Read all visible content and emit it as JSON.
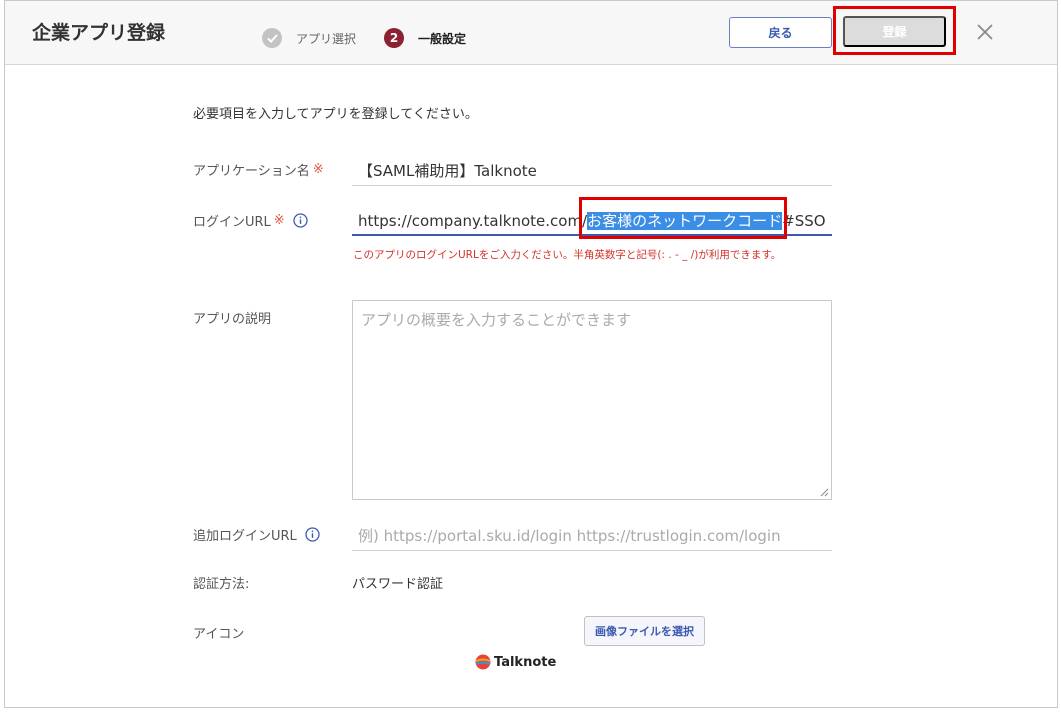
{
  "dialog": {
    "title": "企業アプリ登録"
  },
  "steps": [
    {
      "label": "アプリ選択",
      "number": "✓",
      "status": "done"
    },
    {
      "label": "一般設定",
      "number": "2",
      "status": "current"
    }
  ],
  "header_buttons": {
    "back_label": "戻る",
    "register_label": "登録"
  },
  "form": {
    "intro": "必要項目を入力してアプリを登録してください。",
    "app_name": {
      "label": "アプリケーション名",
      "required_mark": "※",
      "value": "【SAML補助用】Talknote"
    },
    "login_url": {
      "label": "ログインURL",
      "required_mark": "※",
      "value_prefix": "https://company.talknote.com/",
      "value_selected": "お客様のネットワークコード",
      "value_suffix": "#SSO",
      "hint": "このアプリのログインURLをご入力ください。半角英数字と記号(: . - _ /)が利用できます。"
    },
    "description": {
      "label": "アプリの説明",
      "placeholder": "アプリの概要を入力することができます"
    },
    "extra_login_url": {
      "label": "追加ログインURL",
      "placeholder": "例) https://portal.sku.id/login https://trustlogin.com/login"
    },
    "auth_method": {
      "label": "認証方法:",
      "value": "パスワード認証"
    },
    "icon": {
      "label": "アイコン",
      "file_button_label": "画像ファイルを選択",
      "logo_text": "Talknote"
    }
  },
  "colors": {
    "accent": "#3d5ab0",
    "step_current": "#8a2231",
    "required": "#e0573f",
    "error": "#d3312a",
    "highlight_box": "#e00000",
    "selection": "#3a8ee6"
  }
}
